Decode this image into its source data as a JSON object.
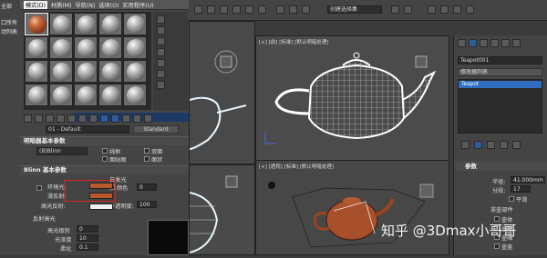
{
  "left_panel": {
    "items": [
      "全部",
      "口所有",
      "动列表"
    ]
  },
  "material_editor": {
    "menu": [
      {
        "label": "模式(D)",
        "selected": true
      },
      {
        "label": "材质(M)",
        "selected": false
      },
      {
        "label": "导航(N)",
        "selected": false
      },
      {
        "label": "选项(O)",
        "selected": false
      },
      {
        "label": "实用程序(U)",
        "selected": false
      }
    ],
    "slot_count": 20,
    "active_slot": 0,
    "material_name": "01 - Default",
    "material_type": "Standard",
    "shader_rollout": {
      "title": "明暗器基本参数",
      "shader": "(B)Blinn",
      "options": [
        {
          "label": "线框",
          "checked": false
        },
        {
          "label": "双面",
          "checked": false
        },
        {
          "label": "面贴图",
          "checked": false
        },
        {
          "label": "面状",
          "checked": false
        }
      ]
    },
    "blinn_rollout": {
      "title": "Blinn 基本参数",
      "self_illum": "自发光",
      "color_label": "颜色",
      "color_value": "0",
      "ambient_label": "环境光:",
      "diffuse_label": "漫反射:",
      "specular_label": "高光反射:",
      "opacity_label": "不透明度:",
      "opacity_value": "100",
      "spec_highlights": "反射高光",
      "spec_level_label": "高光级别",
      "spec_level_value": "0",
      "gloss_label": "光泽度",
      "gloss_value": "10",
      "soften_label": "柔化",
      "soften_value": "0.1"
    }
  },
  "viewports": {
    "top_right_label": "[+] [前] [标准] [默认明暗处理]",
    "bottom_right_label": "[+] [透视] [标准] [默认明暗处理]",
    "top_toolbar_text": "创建选择集"
  },
  "command_panel": {
    "object_name": "Teapot001",
    "modifier_list": "修改器列表",
    "stack_item": "Teapot",
    "params_title": "参数",
    "radius_label": "半径:",
    "radius_value": "41.000mm",
    "segments_label": "分段:",
    "segments_value": "17",
    "smooth_label": "平滑",
    "parts_title": "茶壶部件",
    "parts": [
      "壶体",
      "壶把",
      "壶嘴",
      "壶盖"
    ]
  },
  "watermark": "知乎 @3Dmax小哥哥",
  "colors": {
    "diffuse": "#b9582d",
    "selection": "#2f6dc0",
    "highlight_box": "#dd2222"
  }
}
